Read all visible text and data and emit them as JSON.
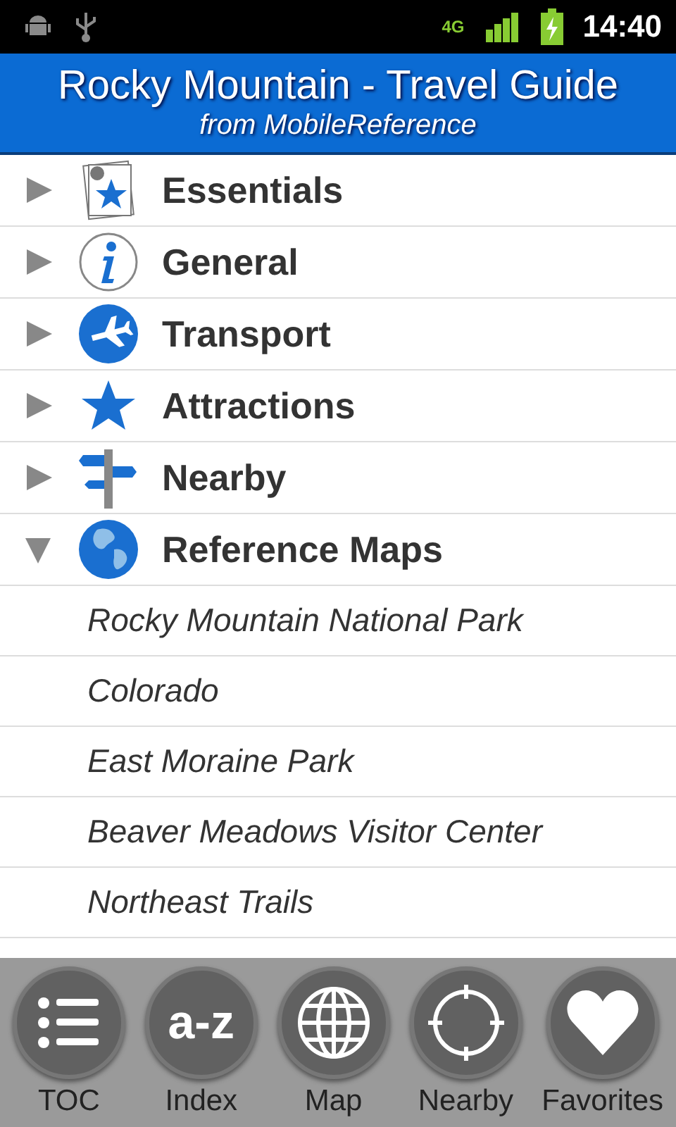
{
  "status_bar": {
    "network": "4G",
    "time": "14:40"
  },
  "header": {
    "title": "Rocky Mountain - Travel Guide",
    "subtitle": "from MobileReference"
  },
  "sections": [
    {
      "label": "Essentials",
      "kind": "essentials",
      "expanded": false
    },
    {
      "label": "General",
      "kind": "info",
      "expanded": false
    },
    {
      "label": "Transport",
      "kind": "plane",
      "expanded": false
    },
    {
      "label": "Attractions",
      "kind": "star",
      "expanded": false
    },
    {
      "label": "Nearby",
      "kind": "signpost",
      "expanded": false
    },
    {
      "label": "Reference Maps",
      "kind": "globe",
      "expanded": true,
      "children": [
        {
          "label": "Rocky Mountain National Park"
        },
        {
          "label": "Colorado"
        },
        {
          "label": "East Moraine Park"
        },
        {
          "label": "Beaver Meadows Visitor Center"
        },
        {
          "label": "Northeast Trails"
        }
      ]
    }
  ],
  "toolbar": [
    {
      "label": "TOC",
      "kind": "list"
    },
    {
      "label": "Index",
      "kind": "az",
      "icon_text": "a-z"
    },
    {
      "label": "Map",
      "kind": "globe"
    },
    {
      "label": "Nearby",
      "kind": "crosshair"
    },
    {
      "label": "Favorites",
      "kind": "heart"
    }
  ]
}
